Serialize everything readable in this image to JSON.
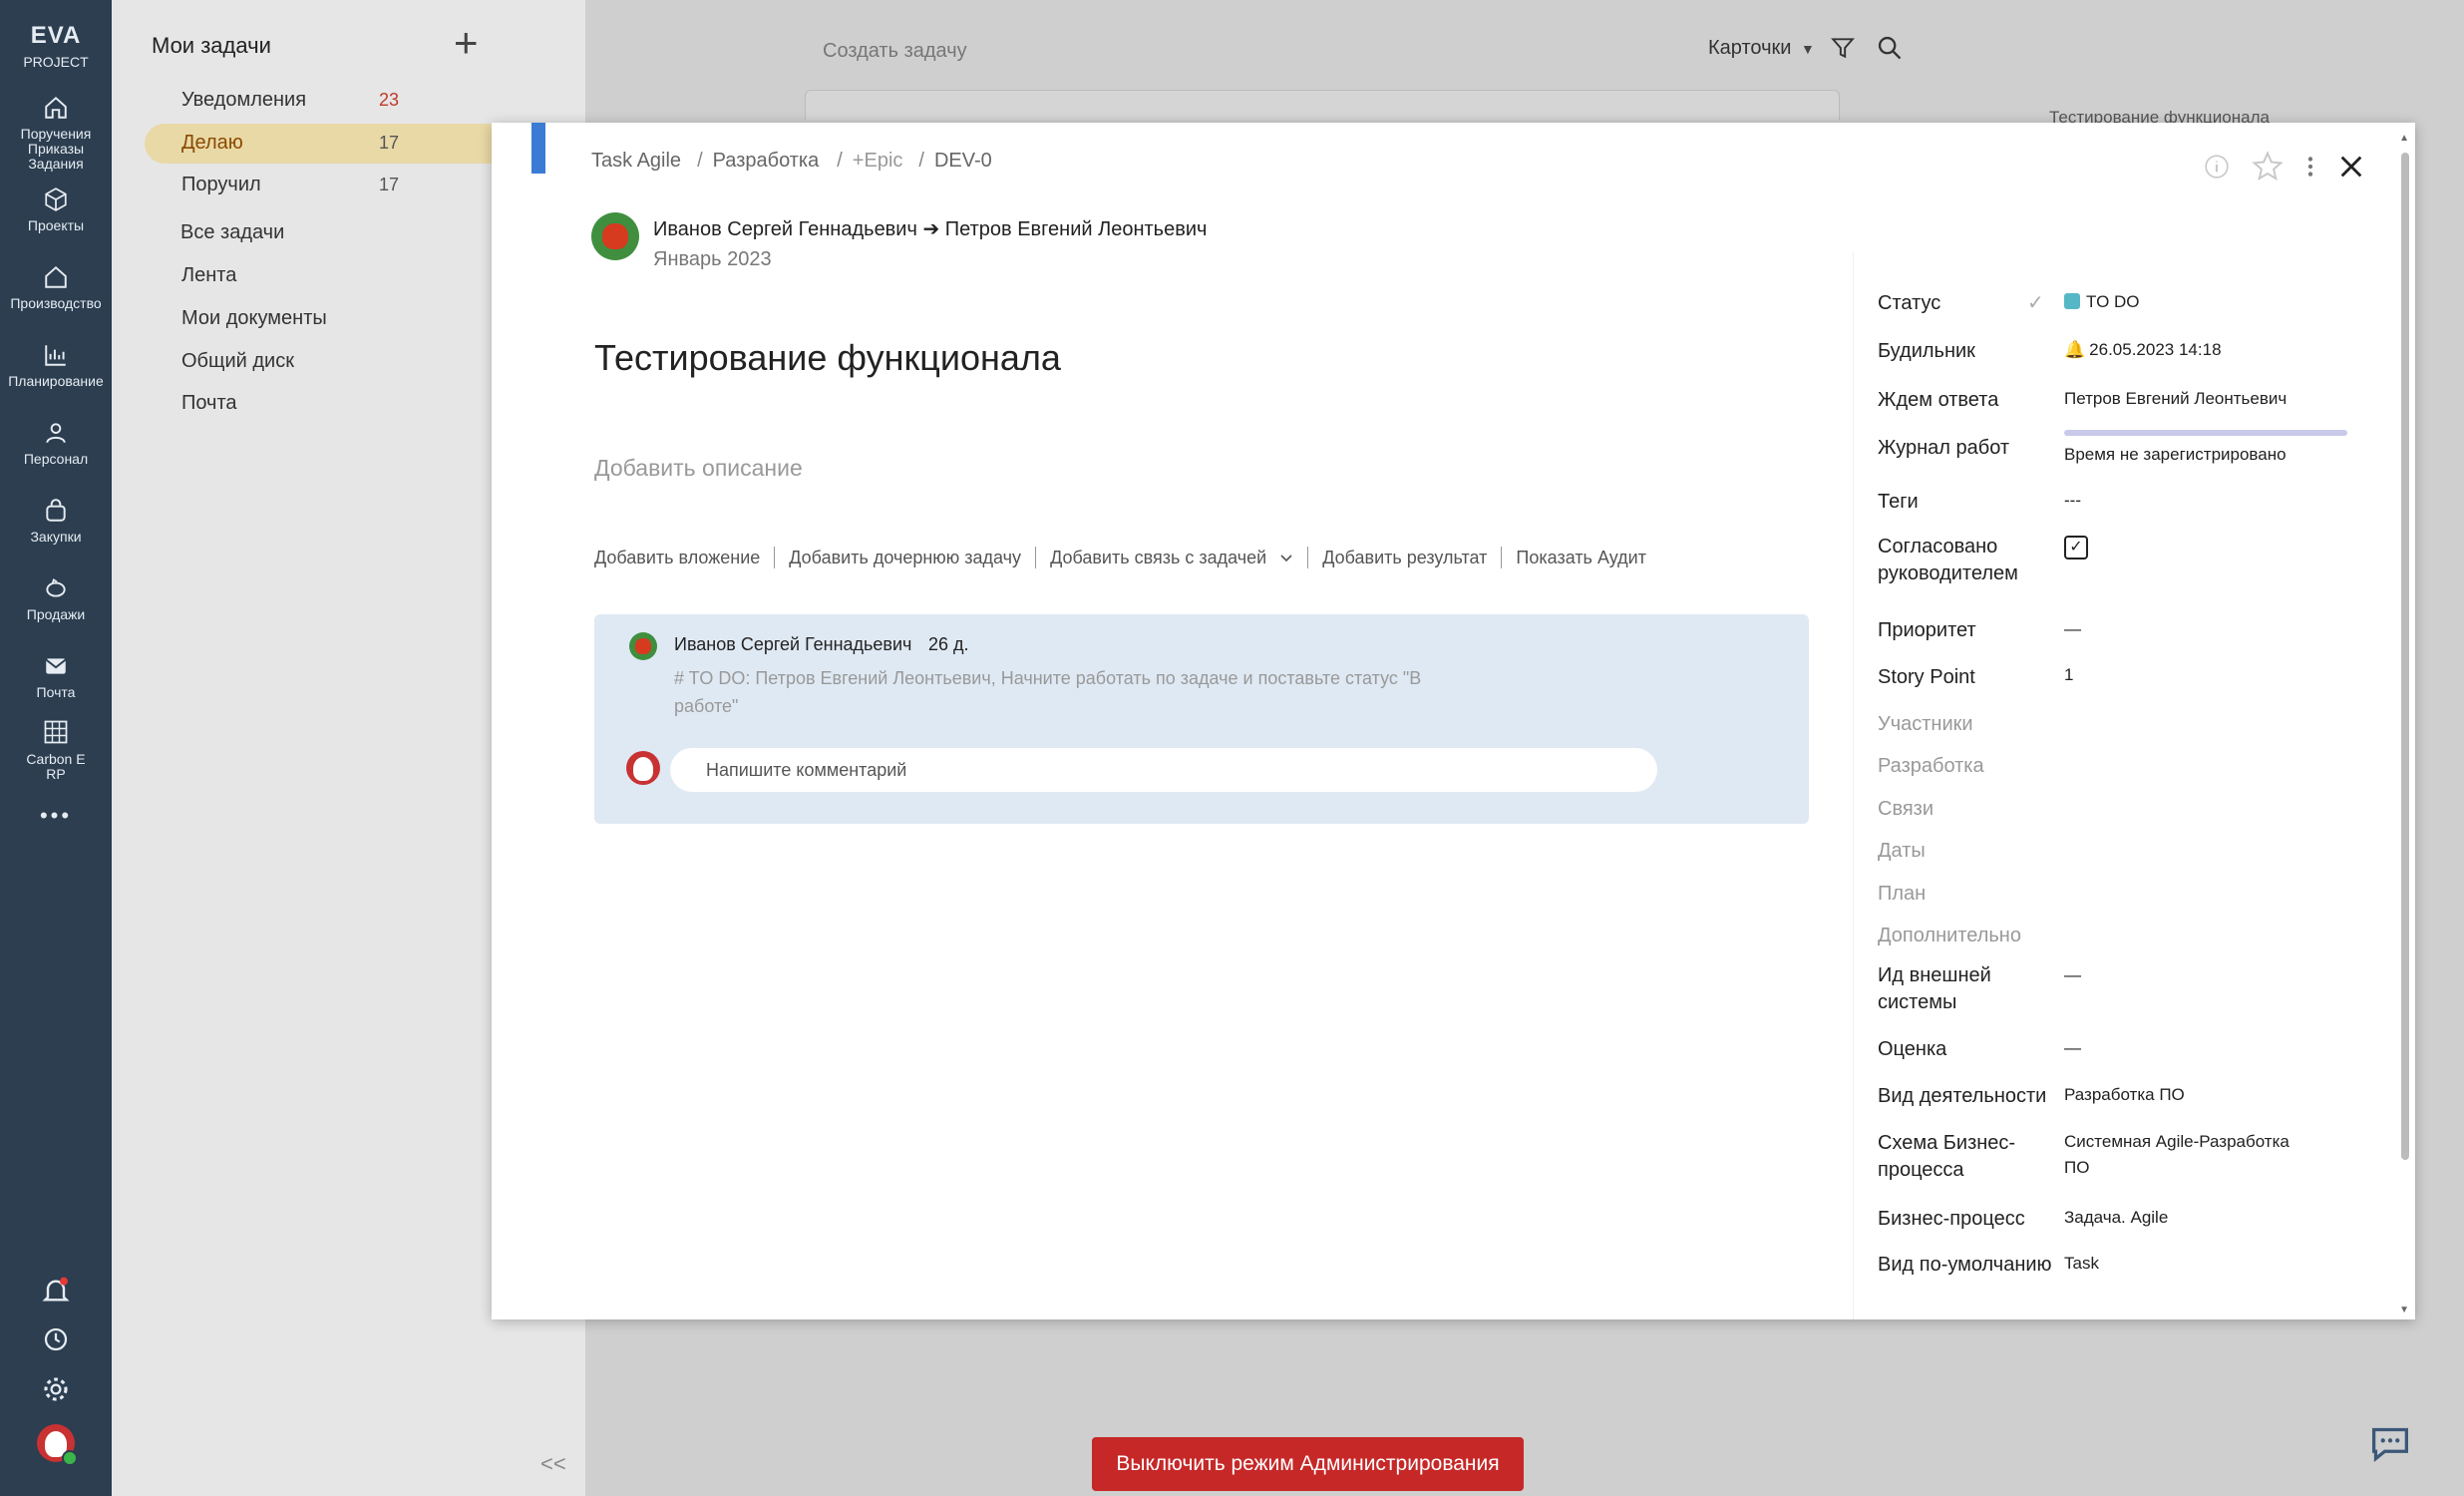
{
  "brand": {
    "line1": "EVA",
    "line2": "PROJECT"
  },
  "rail": [
    {
      "label_lines": [
        "Поручения",
        "Приказы",
        "Задания"
      ],
      "icon": "home-icon"
    },
    {
      "label_lines": [
        "Проекты"
      ],
      "icon": "cube-icon"
    },
    {
      "label_lines": [
        "Производство"
      ],
      "icon": "factory-icon"
    },
    {
      "label_lines": [
        "Планирование"
      ],
      "icon": "chart-icon"
    },
    {
      "label_lines": [
        "Персонал"
      ],
      "icon": "person-icon"
    },
    {
      "label_lines": [
        "Закупки"
      ],
      "icon": "basket-icon"
    },
    {
      "label_lines": [
        "Продажи"
      ],
      "icon": "piggy-icon"
    },
    {
      "label_lines": [
        "Почта"
      ],
      "icon": "mail-icon"
    },
    {
      "label_lines": [
        "Carbon E",
        "RP"
      ],
      "icon": "grid-icon"
    }
  ],
  "rail_more": "•••",
  "tasks_panel": {
    "title": "Мои задачи",
    "add": "+",
    "items": [
      {
        "label": "Уведомления",
        "count": "23"
      },
      {
        "label": "Делаю",
        "count": "17"
      },
      {
        "label": "Поручил",
        "count": "17"
      },
      {
        "label": "Все задачи"
      },
      {
        "label": "Лента"
      },
      {
        "label": "Мои документы"
      },
      {
        "label": "Общий диск"
      },
      {
        "label": "Почта"
      }
    ],
    "collapse": "<<"
  },
  "background": {
    "create_task": "Создать задачу",
    "view_mode": "Карточки",
    "card_title": "Тестирование функционала"
  },
  "modal": {
    "breadcrumbs": [
      "Task Agile",
      "Разработка",
      "+Epic",
      "DEV-0"
    ],
    "author_from": "Иванов Сергей Геннадьевич",
    "arrow": "➔",
    "author_to": "Петров Евгений Леонтьевич",
    "period": "Январь 2023",
    "title": "Тестирование функционала",
    "description_placeholder": "Добавить описание",
    "actions": [
      "Добавить вложение",
      "Добавить дочернюю задачу",
      "Добавить связь с задачей",
      "Добавить результат",
      "Показать Аудит"
    ],
    "comment": {
      "author": "Иванов Сергей Геннадьевич",
      "age": "26 д.",
      "text": "# TO DO: Петров Евгений Леонтьевич, Начните работать по задаче и поставьте статус \"В работе\""
    },
    "comment_placeholder": "Напишите комментарий"
  },
  "props": {
    "status_label": "Статус",
    "status_value": "TO DO",
    "status_color": "#56b7c6",
    "alarm_label": "Будильник",
    "alarm_value": "26.05.2023 14:18",
    "waiting_label": "Ждем ответа",
    "waiting_value": "Петров Евгений Леонтьевич",
    "worklog_label": "Журнал работ",
    "worklog_value": "Время не зарегистрировано",
    "tags_label": "Теги",
    "tags_value": "---",
    "approved_label": "Согласовано руководителем",
    "approved_value": "✓",
    "priority_label": "Приоритет",
    "priority_value": "—",
    "story_label": "Story Point",
    "story_value": "1",
    "participants_label": "Участники",
    "development_label": "Разработка",
    "links_label": "Связи",
    "dates_label": "Даты",
    "plan_label": "План",
    "extra_label": "Дополнительно",
    "external_id_label": "Ид внешней системы",
    "external_id_value": "—",
    "rating_label": "Оценка",
    "rating_value": "—",
    "activity_label": "Вид деятельности",
    "activity_value": "Разработка ПО",
    "scheme_label": "Схема Бизнес-процесса",
    "scheme_value": "Системная Agile-Разработка ПО",
    "process_label": "Бизнес-процесс",
    "process_value": "Задача. Agile",
    "default_view_label": "Вид по-умолчанию",
    "default_view_value": "Task"
  },
  "admin_button": "Выключить режим Администрирования",
  "colors": {
    "rail": "#2c3e50",
    "active_item": "#e9d9a6",
    "admin": "#c62828",
    "accent": "#3a7bd5"
  }
}
